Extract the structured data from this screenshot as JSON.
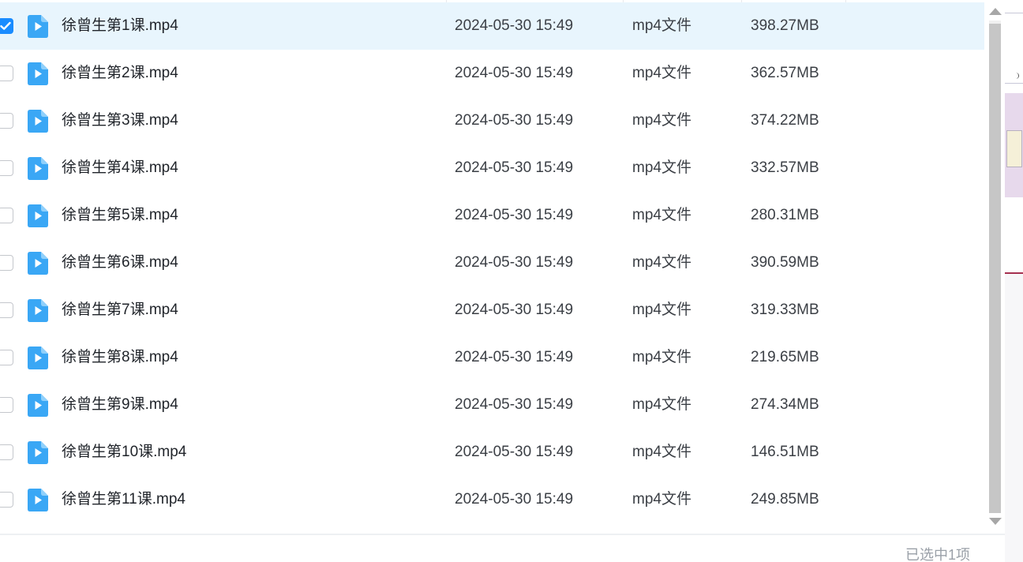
{
  "files": [
    {
      "name": "徐曾生第1课.mp4",
      "date": "2024-05-30 15:49",
      "type": "mp4文件",
      "size": "398.27MB",
      "selected": true
    },
    {
      "name": "徐曾生第2课.mp4",
      "date": "2024-05-30 15:49",
      "type": "mp4文件",
      "size": "362.57MB",
      "selected": false
    },
    {
      "name": "徐曾生第3课.mp4",
      "date": "2024-05-30 15:49",
      "type": "mp4文件",
      "size": "374.22MB",
      "selected": false
    },
    {
      "name": "徐曾生第4课.mp4",
      "date": "2024-05-30 15:49",
      "type": "mp4文件",
      "size": "332.57MB",
      "selected": false
    },
    {
      "name": "徐曾生第5课.mp4",
      "date": "2024-05-30 15:49",
      "type": "mp4文件",
      "size": "280.31MB",
      "selected": false
    },
    {
      "name": "徐曾生第6课.mp4",
      "date": "2024-05-30 15:49",
      "type": "mp4文件",
      "size": "390.59MB",
      "selected": false
    },
    {
      "name": "徐曾生第7课.mp4",
      "date": "2024-05-30 15:49",
      "type": "mp4文件",
      "size": "319.33MB",
      "selected": false
    },
    {
      "name": "徐曾生第8课.mp4",
      "date": "2024-05-30 15:49",
      "type": "mp4文件",
      "size": "219.65MB",
      "selected": false
    },
    {
      "name": "徐曾生第9课.mp4",
      "date": "2024-05-30 15:49",
      "type": "mp4文件",
      "size": "274.34MB",
      "selected": false
    },
    {
      "name": "徐曾生第10课.mp4",
      "date": "2024-05-30 15:49",
      "type": "mp4文件",
      "size": "146.51MB",
      "selected": false
    },
    {
      "name": "徐曾生第11课.mp4",
      "date": "2024-05-30 15:49",
      "type": "mp4文件",
      "size": "249.85MB",
      "selected": false
    }
  ],
  "file_icon": "video-file-icon",
  "status": {
    "selected_count_text": "已选中1项"
  },
  "colors": {
    "accent": "#1a8cff",
    "selected_row": "#e8f5fd",
    "video_icon": "#3aa7f5"
  }
}
